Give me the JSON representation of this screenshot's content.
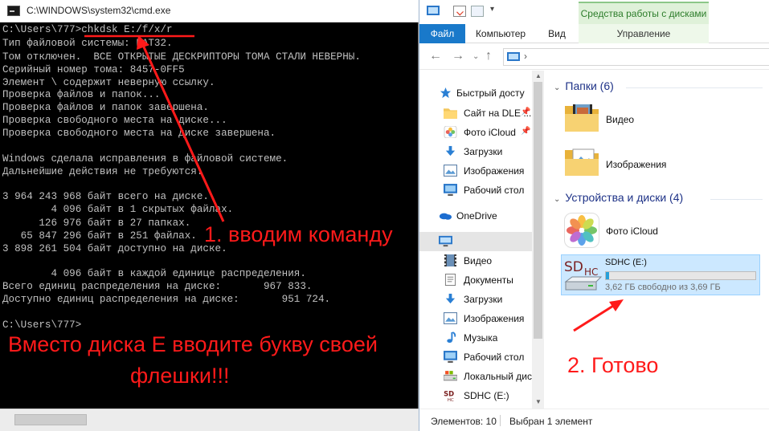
{
  "cmd": {
    "title": "C:\\WINDOWS\\system32\\cmd.exe",
    "lines": [
      "C:\\Users\\777>chkdsk E:/f/x/r",
      "Тип файловой системы: FAT32.",
      "Том отключен.  ВСЕ ОТКРЫТЫЕ ДЕСКРИПТОРЫ ТОМА СТАЛИ НЕВЕРНЫ.",
      "Серийный номер тома: 8457-0FF5",
      "Элемент \\ содержит неверную ссылку.",
      "Проверка файлов и папок...",
      "Проверка файлов и папок завершена.",
      "Проверка свободного места на диске...",
      "Проверка свободного места на диске завершена.",
      "",
      "Windows сделала исправления в файловой системе.",
      "Дальнейшие действия не требуются.",
      "",
      "3 964 243 968 байт всего на диске.",
      "        4 096 байт в 1 скрытых файлах.",
      "      126 976 байт в 27 папках.",
      "   65 847 296 байт в 251 файлах.",
      "3 898 261 504 байт доступно на диске.",
      "",
      "        4 096 байт в каждой единице распределения.",
      "Всего единиц распределения на диске:       967 833.",
      "Доступно единиц распределения на диске:       951 724.",
      "",
      "C:\\Users\\777>"
    ]
  },
  "annotations": {
    "step1": "1. вводим команду",
    "warning_line1": "Вместо диска Е вводите букву своей",
    "warning_line2": "флешки!!!",
    "step2": "2. Готово",
    "color": "#ff1a1a"
  },
  "explorer": {
    "ribbon": {
      "context_group": "Средства работы с дисками",
      "tabs": {
        "file": "Файл",
        "computer": "Компьютер",
        "view": "Вид",
        "manage": "Управление"
      },
      "qa_dropdown": "▾"
    },
    "nav_buttons": {
      "back": "←",
      "forward": "→",
      "recent": "⌄",
      "up": "↑"
    },
    "address_sep": "›",
    "nav_pane": {
      "quick_access": "Быстрый доступ",
      "items": [
        {
          "label": "Сайт на DLE ...",
          "icon": "folder-icon",
          "pinned": true
        },
        {
          "label": "Фото iCloud",
          "icon": "photos-icon",
          "pinned": true
        },
        {
          "label": "Загрузки",
          "icon": "downloads-icon",
          "pinned": false
        },
        {
          "label": "Изображения",
          "icon": "pictures-icon",
          "pinned": false
        },
        {
          "label": "Рабочий стол",
          "icon": "desktop-icon",
          "pinned": false
        }
      ],
      "onedrive": "OneDrive",
      "this_pc_items": [
        {
          "label": "Видео",
          "icon": "video-icon"
        },
        {
          "label": "Документы",
          "icon": "documents-icon"
        },
        {
          "label": "Загрузки",
          "icon": "downloads-icon"
        },
        {
          "label": "Изображения",
          "icon": "pictures-icon"
        },
        {
          "label": "Музыка",
          "icon": "music-icon"
        },
        {
          "label": "Рабочий стол",
          "icon": "desktop-icon"
        },
        {
          "label": "Локальный дис",
          "icon": "local-disk-icon"
        },
        {
          "label": "SDHC (E:)",
          "icon": "sdhc-icon"
        }
      ],
      "pin_glyph": "📌",
      "scroll_up": "▲",
      "scroll_down": "▼"
    },
    "content": {
      "folders_group": "Папки (6)",
      "folders": [
        {
          "label": "Видео"
        },
        {
          "label": "Изображения"
        }
      ],
      "devices_group": "Устройства и диски (4)",
      "devices": [
        {
          "label": "Фото iCloud"
        }
      ],
      "drive": {
        "label": "SDHC (E:)",
        "free_text": "3,62 ГБ свободно из 3,69 ГБ",
        "used_fraction": 0.019,
        "badge": "SDHC"
      },
      "chevron": "⌄"
    },
    "status": {
      "count": "Элементов: 10",
      "selected": "Выбран 1 элемент"
    }
  }
}
